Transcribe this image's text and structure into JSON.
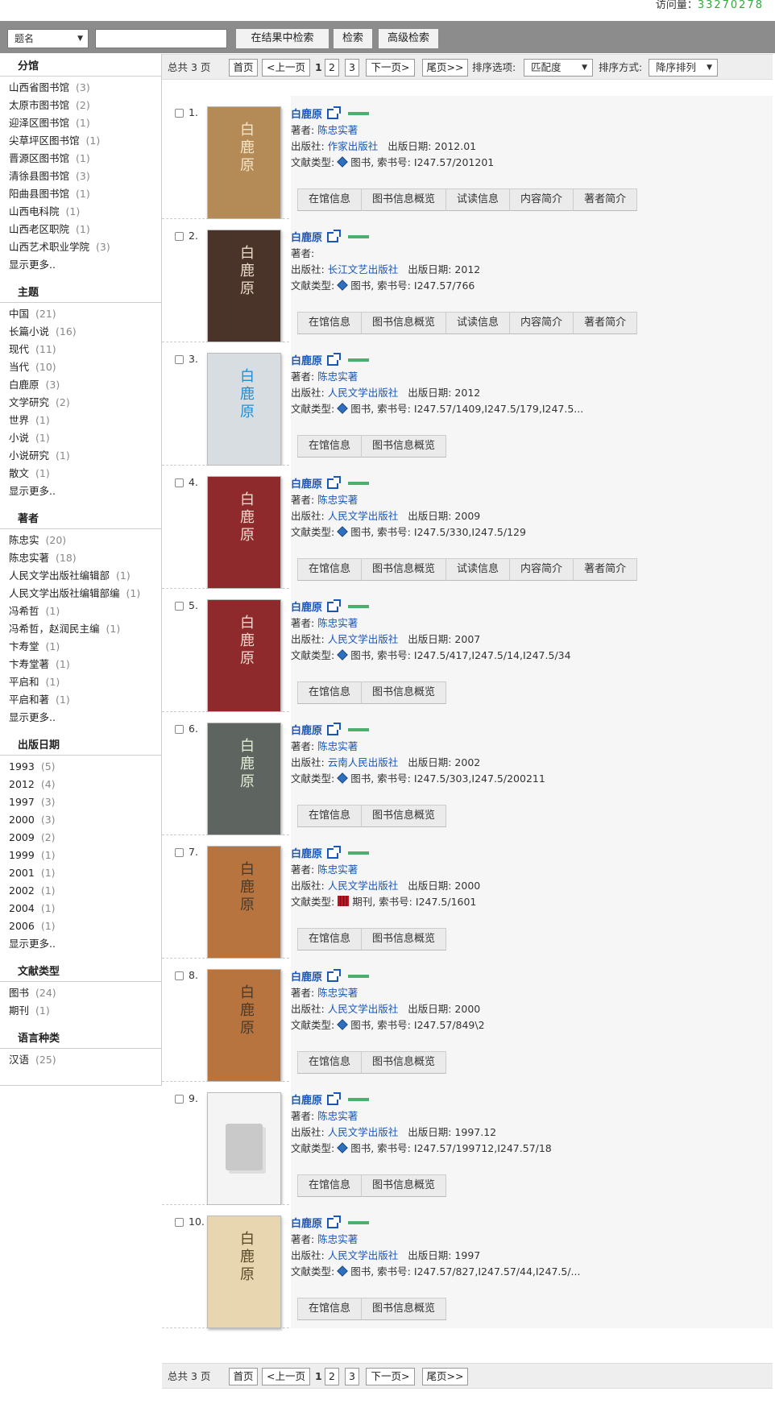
{
  "visitor": {
    "label": "访问量：",
    "count": "33270278"
  },
  "search": {
    "field_select": "题名",
    "query": "",
    "btn_within": "在结果中检索",
    "btn_search": "检索",
    "btn_advanced": "高级检索"
  },
  "facets": [
    {
      "title": "分馆",
      "items": [
        {
          "name": "山西省图书馆",
          "count": "(3)"
        },
        {
          "name": "太原市图书馆",
          "count": "(2)"
        },
        {
          "name": "迎泽区图书馆",
          "count": "(1)"
        },
        {
          "name": "尖草坪区图书馆",
          "count": "(1)"
        },
        {
          "name": "晋源区图书馆",
          "count": "(1)"
        },
        {
          "name": "清徐县图书馆",
          "count": "(3)"
        },
        {
          "name": "阳曲县图书馆",
          "count": "(1)"
        },
        {
          "name": "山西电科院",
          "count": "(1)"
        },
        {
          "name": "山西老区职院",
          "count": "(1)"
        },
        {
          "name": "山西艺术职业学院",
          "count": "(3)"
        }
      ],
      "more": "显示更多.."
    },
    {
      "title": "主题",
      "items": [
        {
          "name": "中国",
          "count": "(21)"
        },
        {
          "name": "长篇小说",
          "count": "(16)"
        },
        {
          "name": "现代",
          "count": "(11)"
        },
        {
          "name": "当代",
          "count": "(10)"
        },
        {
          "name": "白鹿原",
          "count": "(3)"
        },
        {
          "name": "文学研究",
          "count": "(2)"
        },
        {
          "name": "世界",
          "count": "(1)"
        },
        {
          "name": "小说",
          "count": "(1)"
        },
        {
          "name": "小说研究",
          "count": "(1)"
        },
        {
          "name": "散文",
          "count": "(1)"
        }
      ],
      "more": "显示更多.."
    },
    {
      "title": "著者",
      "items": [
        {
          "name": "陈忠实",
          "count": "(20)"
        },
        {
          "name": "陈忠实著",
          "count": "(18)"
        },
        {
          "name": "人民文学出版社编辑部",
          "count": "(1)"
        },
        {
          "name": "人民文学出版社编辑部编",
          "count": "(1)"
        },
        {
          "name": "冯希哲",
          "count": "(1)"
        },
        {
          "name": "冯希哲，赵润民主编",
          "count": "(1)"
        },
        {
          "name": "卞寿堂",
          "count": "(1)"
        },
        {
          "name": "卞寿堂著",
          "count": "(1)"
        },
        {
          "name": "平启和",
          "count": "(1)"
        },
        {
          "name": "平启和著",
          "count": "(1)"
        }
      ],
      "more": "显示更多.."
    },
    {
      "title": "出版日期",
      "items": [
        {
          "name": "1993",
          "count": "(5)"
        },
        {
          "name": "2012",
          "count": "(4)"
        },
        {
          "name": "1997",
          "count": "(3)"
        },
        {
          "name": "2000",
          "count": "(3)"
        },
        {
          "name": "2009",
          "count": "(2)"
        },
        {
          "name": "1999",
          "count": "(1)"
        },
        {
          "name": "2001",
          "count": "(1)"
        },
        {
          "name": "2002",
          "count": "(1)"
        },
        {
          "name": "2004",
          "count": "(1)"
        },
        {
          "name": "2006",
          "count": "(1)"
        }
      ],
      "more": "显示更多.."
    },
    {
      "title": "文献类型",
      "items": [
        {
          "name": "图书",
          "count": "(24)"
        },
        {
          "name": "期刊",
          "count": "(1)"
        }
      ],
      "more": ""
    },
    {
      "title": "语言种类",
      "items": [
        {
          "name": "汉语",
          "count": "(25)"
        }
      ],
      "more": ""
    }
  ],
  "pager": {
    "total": "总共 3 页",
    "first": "首页",
    "prev": "<上一页",
    "pages": [
      "1",
      "2",
      "3"
    ],
    "next": "下一页>",
    "last": "尾页>>",
    "sort_label": "排序选项:",
    "sort_value": "匹配度",
    "order_label": "排序方式:",
    "order_value": "降序排列"
  },
  "labels": {
    "author": "著者:",
    "publisher": "出版社:",
    "pubdate": "出版日期:",
    "doctype": "文献类型:",
    "callno_sep": ", 索书号:"
  },
  "results": [
    {
      "num": "1.",
      "title": "白鹿原",
      "author": "陈忠实著",
      "publisher": "作家出版社",
      "date": "2012.01",
      "type": "图书",
      "type_icon": "book-icon",
      "callno": "I247.57/201201",
      "actions": [
        "在馆信息",
        "图书信息概览",
        "试读信息",
        "内容简介",
        "著者简介"
      ],
      "cover_text": "白鹿原",
      "cover_bg": "#b48a56",
      "cover_fg": "#f5e6c8"
    },
    {
      "num": "2.",
      "title": "白鹿原",
      "author": "",
      "publisher": "长江文艺出版社",
      "date": "2012",
      "type": "图书",
      "type_icon": "book-icon",
      "callno": "I247.57/766",
      "actions": [
        "在馆信息",
        "图书信息概览",
        "试读信息",
        "内容简介",
        "著者简介"
      ],
      "cover_text": "白鹿原",
      "cover_bg": "#4a3328",
      "cover_fg": "#e8dcc8"
    },
    {
      "num": "3.",
      "title": "白鹿原",
      "author": "陈忠实著",
      "publisher": "人民文学出版社",
      "date": "2012",
      "type": "图书",
      "type_icon": "book-icon",
      "callno": "I247.57/1409,I247.5/179,I247.5...",
      "actions": [
        "在馆信息",
        "图书信息概览"
      ],
      "cover_text": "白鹿原",
      "cover_bg": "#d8dde2",
      "cover_fg": "#1e8fd6"
    },
    {
      "num": "4.",
      "title": "白鹿原",
      "author": "陈忠实著",
      "publisher": "人民文学出版社",
      "date": "2009",
      "type": "图书",
      "type_icon": "book-icon",
      "callno": "I247.5/330,I247.5/129",
      "actions": [
        "在馆信息",
        "图书信息概览",
        "试读信息",
        "内容简介",
        "著者简介"
      ],
      "cover_text": "白鹿原",
      "cover_bg": "#8e2a2c",
      "cover_fg": "#f0d8d0"
    },
    {
      "num": "5.",
      "title": "白鹿原",
      "author": "陈忠实著",
      "publisher": "人民文学出版社",
      "date": "2007",
      "type": "图书",
      "type_icon": "book-icon",
      "callno": "I247.5/417,I247.5/14,I247.5/34",
      "actions": [
        "在馆信息",
        "图书信息概览"
      ],
      "cover_text": "白鹿原",
      "cover_bg": "#8e2a2c",
      "cover_fg": "#f0d8d0"
    },
    {
      "num": "6.",
      "title": "白鹿原",
      "author": "陈忠实著",
      "publisher": "云南人民出版社",
      "date": "2002",
      "type": "图书",
      "type_icon": "book-icon",
      "callno": "I247.5/303,I247.5/200211",
      "actions": [
        "在馆信息",
        "图书信息概览"
      ],
      "cover_text": "白鹿原",
      "cover_bg": "#5e6560",
      "cover_fg": "#e3ecd4"
    },
    {
      "num": "7.",
      "title": "白鹿原",
      "author": "陈忠实著",
      "publisher": "人民文学出版社",
      "date": "2000",
      "type": "期刊",
      "type_icon": "magazine-icon",
      "callno": "I247.5/1601",
      "actions": [
        "在馆信息",
        "图书信息概览"
      ],
      "cover_text": "白鹿原",
      "cover_bg": "#b7743f",
      "cover_fg": "#4a3a2a"
    },
    {
      "num": "8.",
      "title": "白鹿原",
      "author": "陈忠实著",
      "publisher": "人民文学出版社",
      "date": "2000",
      "type": "图书",
      "type_icon": "book-icon",
      "callno": "I247.57/849\\2",
      "actions": [
        "在馆信息",
        "图书信息概览"
      ],
      "cover_text": "白鹿原",
      "cover_bg": "#b7743f",
      "cover_fg": "#4a3a2a"
    },
    {
      "num": "9.",
      "title": "白鹿原",
      "author": "陈忠实著",
      "publisher": "人民文学出版社",
      "date": "1997.12",
      "type": "图书",
      "type_icon": "book-icon",
      "callno": "I247.57/199712,I247.57/18",
      "actions": [
        "在馆信息",
        "图书信息概览"
      ],
      "cover_text": "",
      "cover_bg": "#f4f4f4",
      "cover_fg": "#999999"
    },
    {
      "num": "10.",
      "title": "白鹿原",
      "author": "陈忠实著",
      "publisher": "人民文学出版社",
      "date": "1997",
      "type": "图书",
      "type_icon": "book-icon",
      "callno": "I247.57/827,I247.57/44,I247.5/...",
      "actions": [
        "在馆信息",
        "图书信息概览"
      ],
      "cover_text": "白鹿原",
      "cover_bg": "#e8d6b0",
      "cover_fg": "#5a4a2a"
    }
  ]
}
